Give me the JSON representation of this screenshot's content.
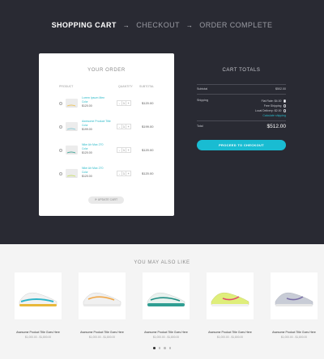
{
  "steps": [
    {
      "label": "SHOPPING CART",
      "active": true
    },
    {
      "label": "CHECKOUT",
      "active": false
    },
    {
      "label": "ORDER COMPLETE",
      "active": false
    }
  ],
  "order": {
    "title": "YOUR ORDER",
    "headers": {
      "product": "PRODUCT",
      "quantity": "QUANTITY",
      "subtotal": "SUBTOTAL"
    },
    "items": [
      {
        "name": "Lorem Ipsum Men",
        "color": "Color",
        "price": "$120.00",
        "qty": "1",
        "subtotal": "$120.00"
      },
      {
        "name": "Awesome Product Title",
        "color": "Color",
        "price": "$199.00",
        "qty": "1",
        "subtotal": "$199.00"
      },
      {
        "name": "Nike Air Max 270",
        "color": "Color",
        "price": "$120.00",
        "qty": "1",
        "subtotal": "$120.00"
      },
      {
        "name": "Nike Air Max 270",
        "color": "Color",
        "price": "$120.00",
        "qty": "1",
        "subtotal": "$120.00"
      }
    ],
    "update_label": "UPDATE CART",
    "thumb_colors": [
      "#f0c24a",
      "#7ac9d6",
      "#2a9e8e",
      "#c9e45a"
    ]
  },
  "totals": {
    "title": "CART TOTALS",
    "subtotal_label": "Subtotal",
    "subtotal_value": "$502.00",
    "shipping_label": "Shipping",
    "shipping_options": [
      {
        "label": "Flat Rate: $4.00",
        "selected": true
      },
      {
        "label": "Free Shipping",
        "selected": false
      },
      {
        "label": "Local Delivery: $2.00",
        "selected": false
      }
    ],
    "calc_shipping": "Calculate shipping",
    "total_label": "Total",
    "total_value": "$512.00",
    "checkout_label": "PROCEED TO CHECKOUT"
  },
  "also_like": {
    "title": "YOU MAY ALSO LIKE",
    "products": [
      {
        "name": "Awesome Product Title Goes Here",
        "price": "$1,000.00 - $1,800.00",
        "shoe_color": "#f2f2f2",
        "accent": "#2fb5c8",
        "sole": "#e8b83a"
      },
      {
        "name": "Awesome Product Title Goes Here",
        "price": "$1,000.00 - $1,800.00",
        "shoe_color": "#f0f0f0",
        "accent": "#f0a84a",
        "sole": "#e8e8e8"
      },
      {
        "name": "Awesome Product Title Goes Here",
        "price": "$1,000.00 - $1,800.00",
        "shoe_color": "#e8f2ee",
        "accent": "#1f8e84",
        "sole": "#2f9e92"
      },
      {
        "name": "Awesome Product Title Goes Here",
        "price": "$1,000.00 - $1,800.00",
        "shoe_color": "#dfee7a",
        "accent": "#e24b6e",
        "sole": "#f0f0f0"
      },
      {
        "name": "Awesome Product Title Goes Here",
        "price": "$1,000.00 - $1,800.00",
        "shoe_color": "#c8ccd6",
        "accent": "#7a6ea8",
        "sole": "#e7e7e7"
      }
    ],
    "dots": 4,
    "active_dot": 0
  }
}
